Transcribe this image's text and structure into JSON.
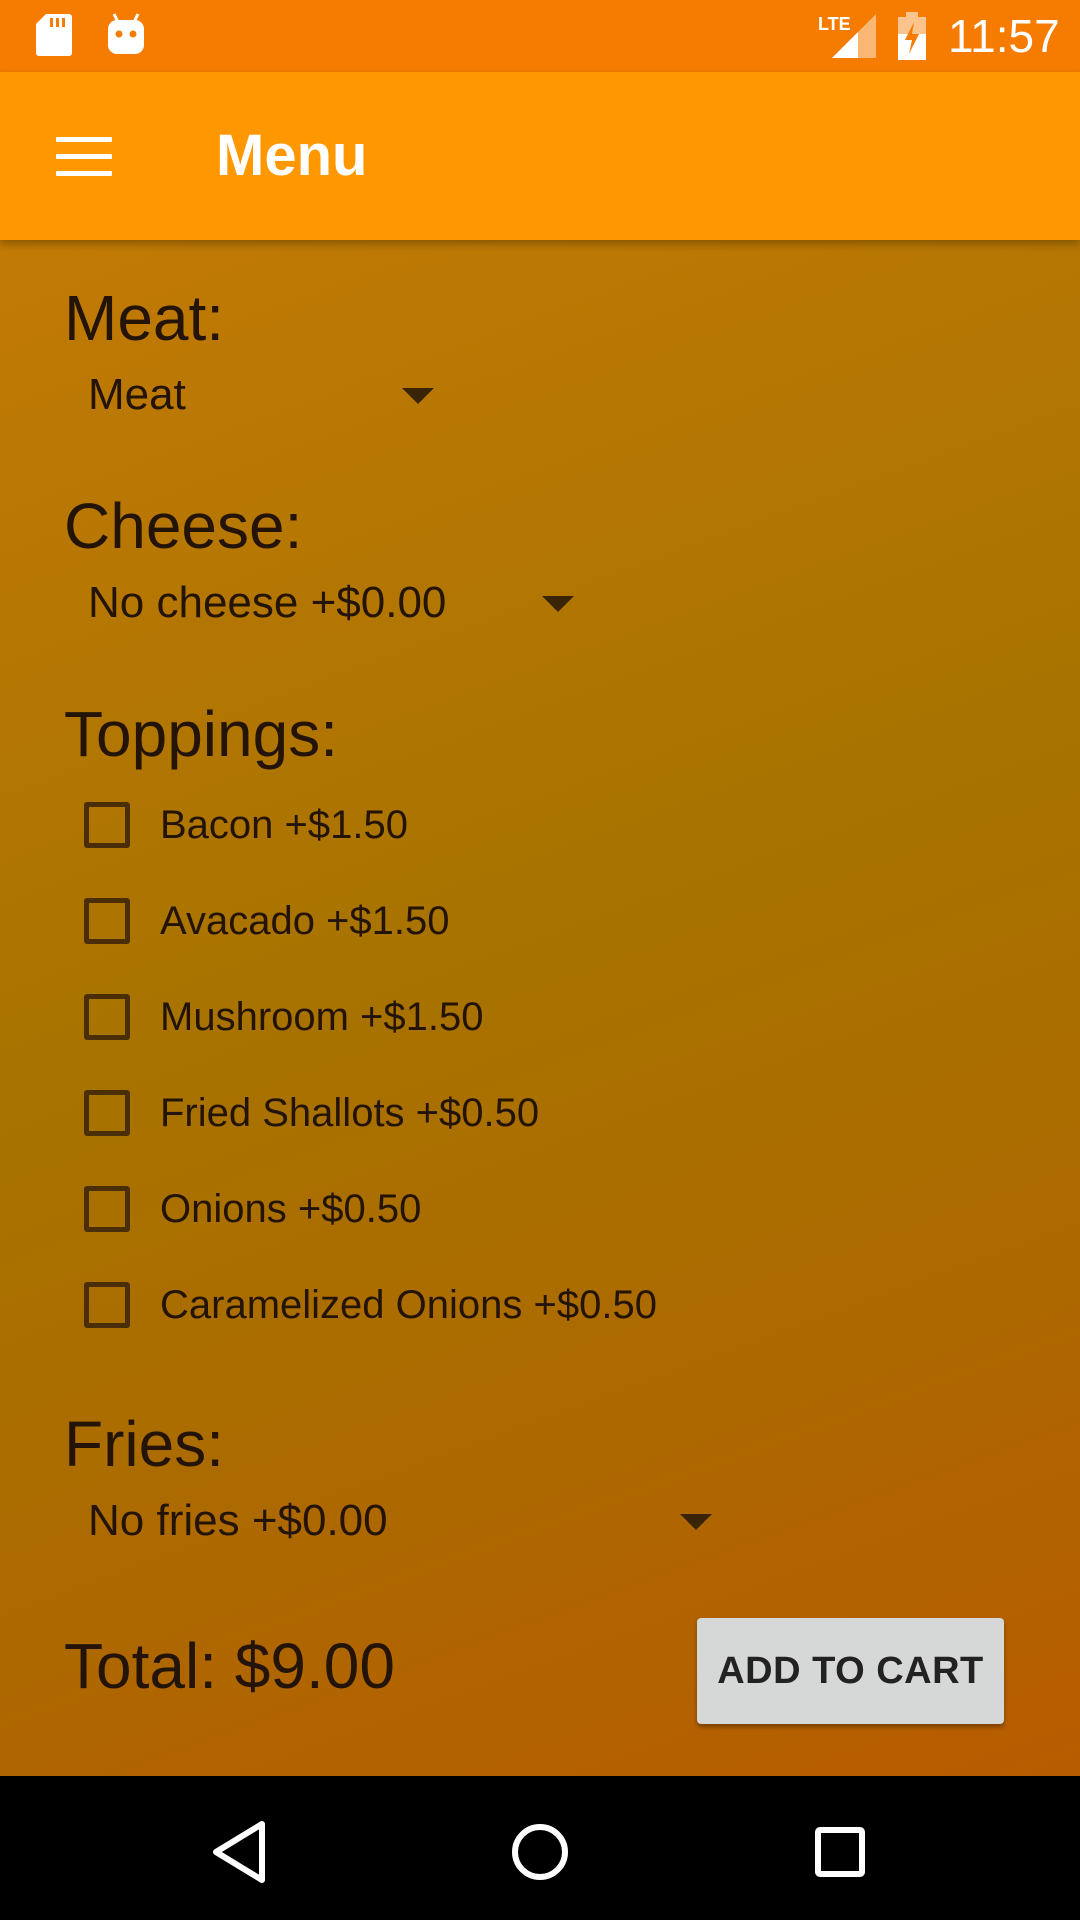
{
  "status_bar": {
    "time": "11:57",
    "network": "LTE",
    "icons": [
      "sd-card-icon",
      "android-debug-icon",
      "lte-signal-icon",
      "battery-charging-icon"
    ]
  },
  "app_bar": {
    "title": "Menu",
    "menu_icon": "hamburger-menu-icon"
  },
  "form": {
    "meat": {
      "label": "Meat:",
      "selected": "Meat"
    },
    "cheese": {
      "label": "Cheese:",
      "selected": "No cheese +$0.00"
    },
    "toppings": {
      "label": "Toppings:",
      "items": [
        {
          "label": "Bacon +$1.50",
          "checked": false
        },
        {
          "label": "Avacado +$1.50",
          "checked": false
        },
        {
          "label": "Mushroom +$1.50",
          "checked": false
        },
        {
          "label": "Fried Shallots +$0.50",
          "checked": false
        },
        {
          "label": "Onions +$0.50",
          "checked": false
        },
        {
          "label": "Caramelized Onions +$0.50",
          "checked": false
        }
      ]
    },
    "fries": {
      "label": "Fries:",
      "selected": "No fries +$0.00"
    }
  },
  "footer": {
    "total": "Total: $9.00",
    "add_button": "ADD TO CART"
  },
  "colors": {
    "status_bar": "#f57c00",
    "app_bar": "#ff9800",
    "text_dark": "#231407",
    "button": "#d6d7d7"
  },
  "nav_bar": {
    "icons": [
      "back-icon",
      "home-icon",
      "recents-icon"
    ]
  }
}
